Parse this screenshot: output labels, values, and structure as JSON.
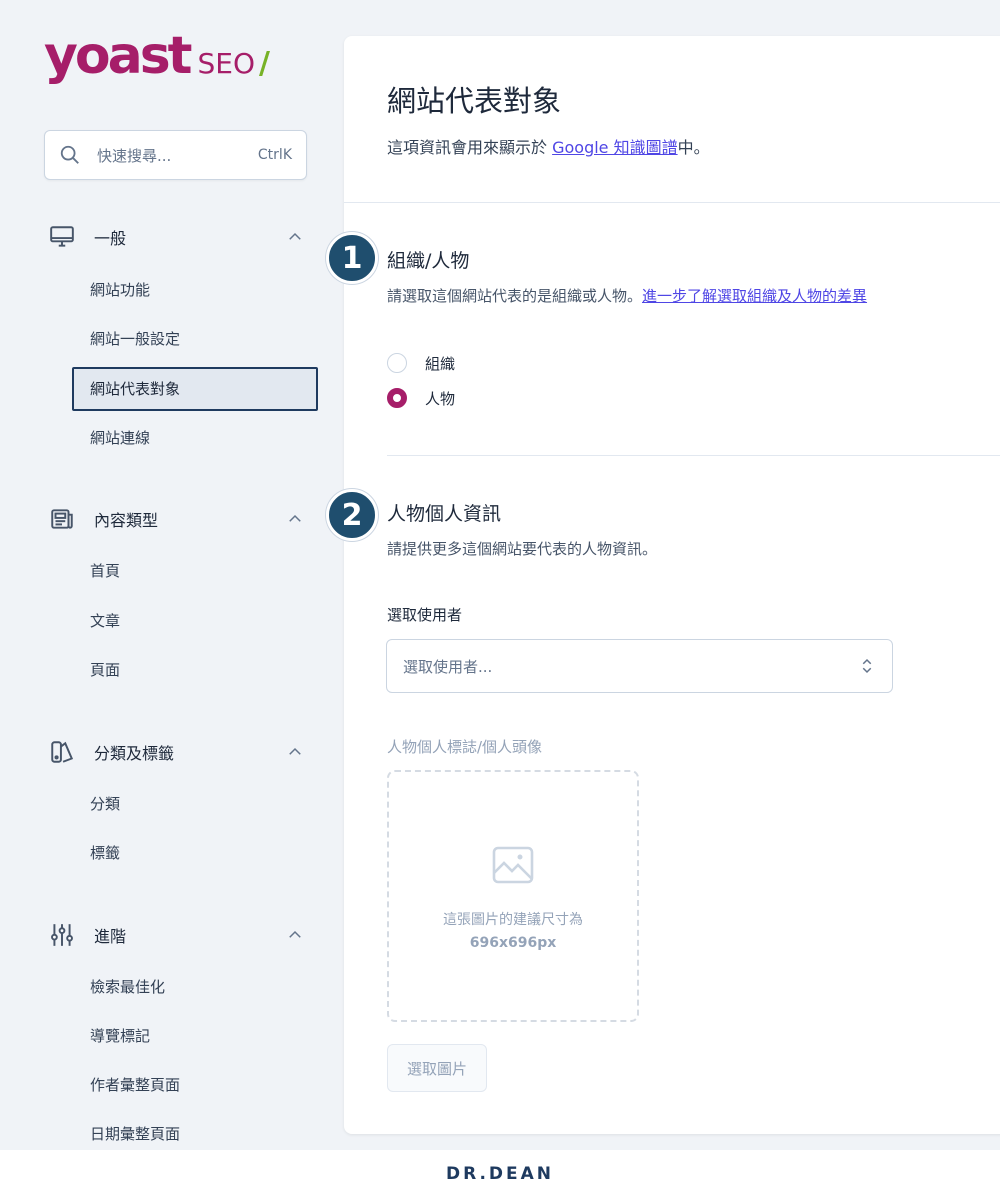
{
  "logo": {
    "yoast": "yoast",
    "seo": "SEO",
    "slash": "/"
  },
  "search": {
    "placeholder": "快速搜尋...",
    "shortcut": "CtrlK"
  },
  "sidebar": {
    "groups": [
      {
        "label": "一般",
        "icon": "desktop-icon",
        "items": [
          "網站功能",
          "網站一般設定",
          "網站代表對象",
          "網站連線"
        ],
        "active": "網站代表對象"
      },
      {
        "label": "內容類型",
        "icon": "newspaper-icon",
        "items": [
          "首頁",
          "文章",
          "頁面"
        ]
      },
      {
        "label": "分類及標籤",
        "icon": "tag-icon",
        "items": [
          "分類",
          "標籤"
        ]
      },
      {
        "label": "進階",
        "icon": "sliders-icon",
        "items": [
          "檢索最佳化",
          "導覽標記",
          "作者彙整頁面",
          "日期彙整頁面"
        ]
      }
    ]
  },
  "main": {
    "title": "網站代表對象",
    "desc_prefix": "這項資訊會用來顯示於 ",
    "desc_link": "Google 知識圖譜",
    "desc_suffix": "中。",
    "section1": {
      "badge": "1",
      "title": "組織/人物",
      "desc_prefix": "請選取這個網站代表的是組織或人物。",
      "desc_link": "進一步了解選取組織及人物的差異",
      "options": [
        "組織",
        "人物"
      ],
      "selected": "人物"
    },
    "section2": {
      "badge": "2",
      "title": "人物個人資訊",
      "desc": "請提供更多這個網站要代表的人物資訊。",
      "user_label": "選取使用者",
      "user_placeholder": "選取使用者...",
      "logo_label": "人物個人標誌/個人頭像",
      "image_hint": "這張圖片的建議尺寸為",
      "image_size": "696x696px",
      "select_image": "選取圖片"
    }
  },
  "footer": {
    "brand": "DR.DEAN"
  },
  "colors": {
    "brand": "#a61e69",
    "accent_green": "#77b227",
    "badge": "#1f4e6e",
    "link": "#4f46e5"
  }
}
